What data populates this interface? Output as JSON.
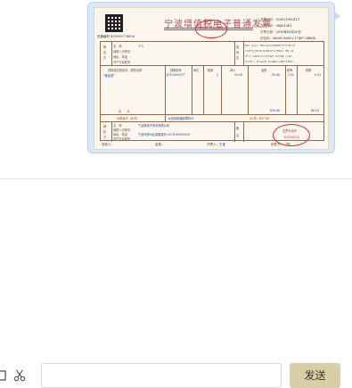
{
  "invoice": {
    "title": "宁波增值税电子普通发票",
    "qr_caption": "机器编号 499099774806",
    "seal_text": "全国统一发票监制章",
    "meta": [
      {
        "label": "发票代码",
        "value": "033021900111"
      },
      {
        "label": "发票号码",
        "value": "08831961"
      },
      {
        "label": "开票日期",
        "value": "2019年05月25日"
      },
      {
        "label": "校验码",
        "value": "06061 86012 17497 04654"
      }
    ],
    "buyer_labels": [
      "名　称",
      "纳税人识别号",
      "地址、电话",
      "开户行及账号"
    ],
    "buyer_name": "个人",
    "password_lines": [
      "03*-1*+/-*0>>1<77/0355*1*1*8/*2",
      "<*277/74/2>3/3617>>*04</-58-<2",
      "3*<-*+0+5<7/77/62*-47/94-//27",
      "7/<3*--1*+2+0-17<28/</20*/4<5/-"
    ],
    "item_headers": [
      "货物或应税劳务、服务名称",
      "规格型号",
      "单位",
      "数量",
      "单价",
      "金额",
      "税率",
      "税额"
    ],
    "item_row": {
      "name": "*食品类*",
      "spec": "JD1000001/*",
      "unit": "",
      "qty": "1",
      "price": "50.88",
      "amount": "50.88",
      "rate": "13%",
      "tax": "6.61"
    },
    "total_label": "合　　计",
    "total_amount": "¥50.88",
    "total_tax": "¥6.61",
    "total_words_label": "价税合计（大写）",
    "total_words": "⊗伍拾柒圆肆角玖分",
    "total_small": "（小写）¥57.49",
    "seller_labels": [
      "名　称",
      "纳税人识别号",
      "地址、电话",
      "开户行及账号"
    ],
    "seller_name": "宁波某电子商务有限公司",
    "seller_addr": "宁波市鄞州区某路某号 0574-89090000",
    "seal2_text": "发票专用章",
    "seal2_number": "30009109",
    "footer_payee_label": "收款人：",
    "footer_checker_label": "复核：",
    "footer_drawer_label": "开票人：",
    "footer_drawer": "王某",
    "footer_seller_label": "销售方：（章）"
  },
  "toolbar": {
    "left_icon": "folder-icon",
    "cut_icon": "scissors-icon"
  },
  "input": {
    "placeholder": "",
    "value": ""
  },
  "send_label": "发送",
  "colors": {
    "send_bg": "#d9cfa6",
    "bubble_bg": "#dbe9f7",
    "seal": "#d0303a",
    "title": "#b5485a"
  }
}
